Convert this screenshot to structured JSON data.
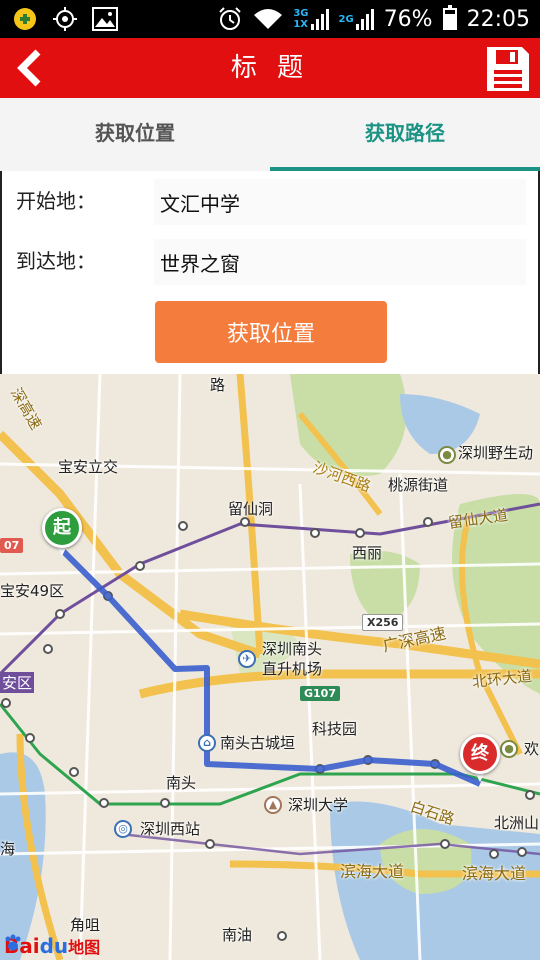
{
  "status_bar": {
    "network_top": "3G",
    "network_sub": "1X",
    "network2": "2G",
    "battery": "76%",
    "battery_level": 0.76,
    "time": "22:05"
  },
  "title_bar": {
    "title": "标 题"
  },
  "tabs": [
    {
      "label": "获取位置",
      "active": false
    },
    {
      "label": "获取路径",
      "active": true
    }
  ],
  "form": {
    "start_label": "开始地：",
    "start_value": "文汇中学",
    "end_label": "到达地：",
    "end_value": "世界之窗",
    "button_label": "获取位置"
  },
  "map": {
    "labels": {
      "lu": "路",
      "baoan_lijiao": "宝安立交",
      "liuxiandong": "留仙洞",
      "shahe_xilu": "沙河西路",
      "taoyuan_jiedao": "桃源街道",
      "shenzhen_yeshengdong": "深圳野生动",
      "liuxian_dadao": "留仙大道",
      "xili": "西丽",
      "baoan_49": "宝安49区",
      "guangshen_gaosu": "广深高速",
      "nantou_heliport": "深圳南头",
      "nantou_heliport2": "直升机场",
      "beihuan_dadao": "北环大道",
      "anqu": "安区",
      "kejiyuan": "科技园",
      "nantou_gucheng": "南头古城垣",
      "nantou": "南头",
      "szu": "深圳大学",
      "baishi_lu": "白石路",
      "beizhou": "北洲山",
      "sz_xi": "深圳西站",
      "binhai_dadao": "滨海大道",
      "binhai_dadao2": "滨海大道",
      "jiaozui": "角咀",
      "nanyou": "南油",
      "huan": "欢",
      "hai": "海",
      "shengao": "深高速",
      "x256": "X256",
      "g107": "G107",
      "num_107": "07"
    },
    "start_marker": "起",
    "end_marker": "终",
    "logo_bai": "Bai",
    "logo_du": "du",
    "logo_ditu": "地图",
    "colors": {
      "route": "#3a5fcd",
      "metro_purple": "#6f4f9c",
      "metro_green": "#2ea44f",
      "highway": "#f2c14e",
      "water": "#a9c9e6",
      "green": "#c8dea6"
    }
  }
}
